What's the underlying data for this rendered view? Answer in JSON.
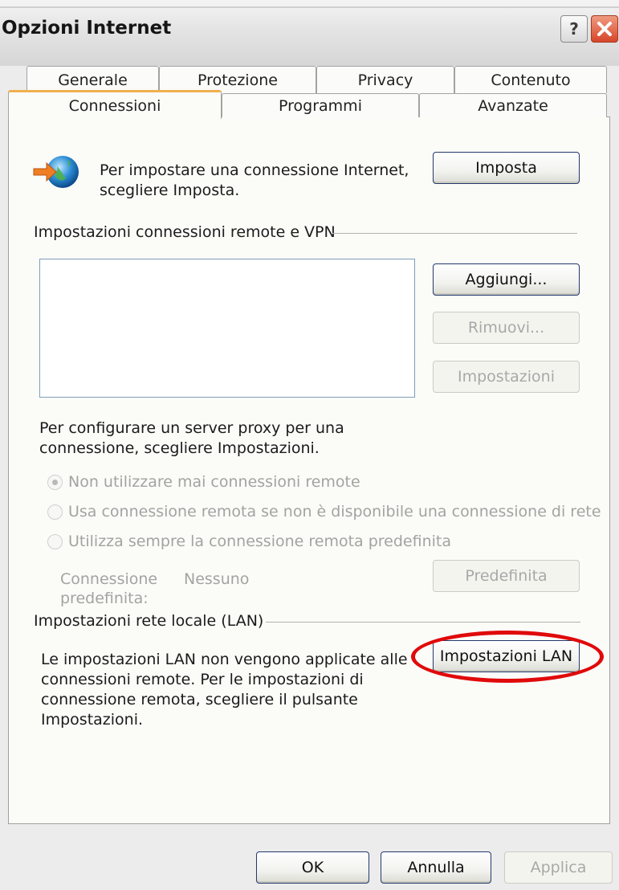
{
  "window": {
    "title": "Opzioni Internet",
    "help_label": "?",
    "icons": {
      "help": "help-icon",
      "close": "close-icon",
      "connection": "network-globe-icon"
    }
  },
  "tabs": {
    "row1": [
      "Generale",
      "Protezione",
      "Privacy",
      "Contenuto"
    ],
    "row2": [
      "Connessioni",
      "Programmi",
      "Avanzate"
    ],
    "active": "Connessioni"
  },
  "setup": {
    "text_line1": "Per impostare una connessione Internet,",
    "text_line2": "scegliere Imposta.",
    "button": "Imposta"
  },
  "dialup": {
    "section_label": "Impostazioni connessioni remote e VPN",
    "add_button": "Aggiungi...",
    "remove_button": "Rimuovi...",
    "settings_button": "Impostazioni",
    "proxy_text_line1": "Per configurare un server proxy per una",
    "proxy_text_line2": "connessione, scegliere Impostazioni.",
    "options": [
      "Non utilizzare mai connessioni remote",
      "Usa connessione remota se non è disponibile una connessione di rete",
      "Utilizza sempre la connessione remota predefinita"
    ],
    "selected_option": 0,
    "default_label_line1": "Connessione",
    "default_label_line2": "predefinita:",
    "default_value": "Nessuno",
    "default_button": "Predefinita"
  },
  "lan": {
    "section_label": "Impostazioni rete locale (LAN)",
    "text_lines": [
      "Le impostazioni LAN non vengono applicate alle",
      "connessioni remote. Per le impostazioni di",
      "connessione remota, scegliere il pulsante",
      "Impostazioni."
    ],
    "button": "Impostazioni LAN",
    "highlight_color": "#e00a0a"
  },
  "footer": {
    "ok": "OK",
    "cancel": "Annulla",
    "apply": "Applica"
  }
}
